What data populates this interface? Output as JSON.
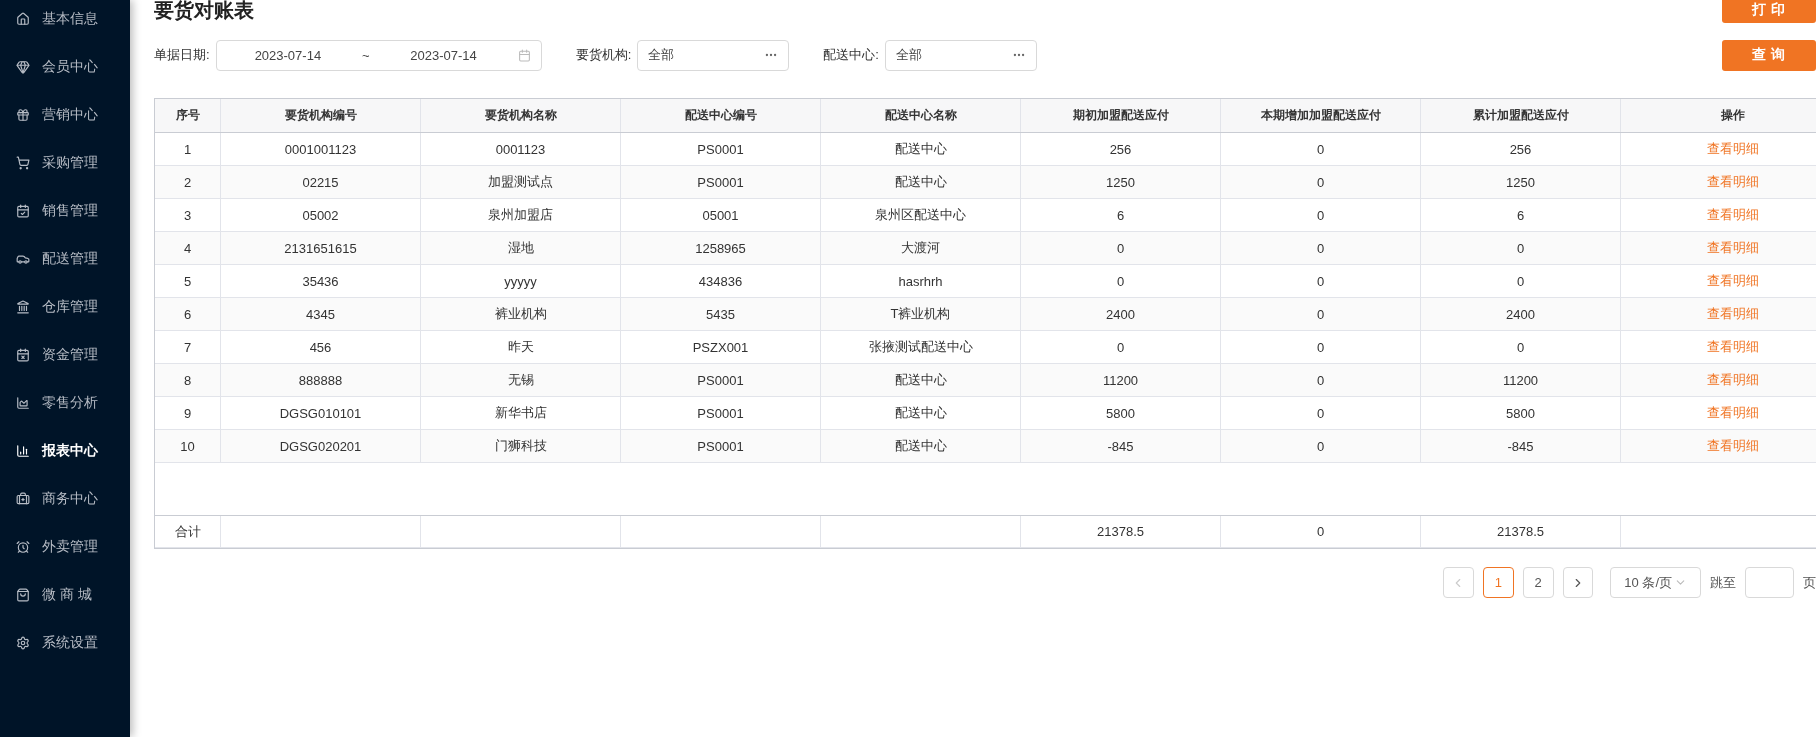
{
  "sidebar": {
    "items": [
      {
        "label": "基本信息",
        "selected": false
      },
      {
        "label": "会员中心",
        "selected": false
      },
      {
        "label": "营销中心",
        "selected": false
      },
      {
        "label": "采购管理",
        "selected": false
      },
      {
        "label": "销售管理",
        "selected": false
      },
      {
        "label": "配送管理",
        "selected": false
      },
      {
        "label": "仓库管理",
        "selected": false
      },
      {
        "label": "资金管理",
        "selected": false
      },
      {
        "label": "零售分析",
        "selected": false
      },
      {
        "label": "报表中心",
        "selected": true
      },
      {
        "label": "商务中心",
        "selected": false
      },
      {
        "label": "外卖管理",
        "selected": false
      },
      {
        "label": "微 商 城",
        "selected": false
      },
      {
        "label": "系统设置",
        "selected": false
      }
    ]
  },
  "title": "要货对账表",
  "print_button": "打 印",
  "query_button": "查 询",
  "filters": [
    {
      "kind": "daterange",
      "label": "单据日期:",
      "start": "2023-07-14",
      "separator": "~",
      "end": "2023-07-14"
    },
    {
      "kind": "select",
      "label": "要货机构:",
      "value": "全部"
    },
    {
      "kind": "select",
      "label": "配送中心:",
      "value": "全部"
    }
  ],
  "table": {
    "columns": [
      "序号",
      "要货机构编号",
      "要货机构名称",
      "配送中心编号",
      "配送中心名称",
      "期初加盟配送应付",
      "本期增加加盟配送应付",
      "累计加盟配送应付",
      "操作"
    ],
    "rows": [
      {
        "cells": [
          "1",
          "0001001123",
          "0001123",
          "PS0001",
          "配送中心",
          "256",
          "0",
          "256"
        ],
        "action": "查看明细"
      },
      {
        "cells": [
          "2",
          "02215",
          "加盟测试点",
          "PS0001",
          "配送中心",
          "1250",
          "0",
          "1250"
        ],
        "action": "查看明细"
      },
      {
        "cells": [
          "3",
          "05002",
          "泉州加盟店",
          "05001",
          "泉州区配送中心",
          "6",
          "0",
          "6"
        ],
        "action": "查看明细"
      },
      {
        "cells": [
          "4",
          "2131651615",
          "湿地",
          "1258965",
          "大渡河",
          "0",
          "0",
          "0"
        ],
        "action": "查看明细"
      },
      {
        "cells": [
          "5",
          "35436",
          "yyyyy",
          "434836",
          "hasrhrh",
          "0",
          "0",
          "0"
        ],
        "action": "查看明细"
      },
      {
        "cells": [
          "6",
          "4345",
          "裤业机构",
          "5435",
          "T裤业机构",
          "2400",
          "0",
          "2400"
        ],
        "action": "查看明细"
      },
      {
        "cells": [
          "7",
          "456",
          "昨天",
          "PSZX001",
          "张掖测试配送中心",
          "0",
          "0",
          "0"
        ],
        "action": "查看明细"
      },
      {
        "cells": [
          "8",
          "888888",
          "无锡",
          "PS0001",
          "配送中心",
          "11200",
          "0",
          "11200"
        ],
        "action": "查看明细"
      },
      {
        "cells": [
          "9",
          "DGSG010101",
          "新华书店",
          "PS0001",
          "配送中心",
          "5800",
          "0",
          "5800"
        ],
        "action": "查看明细"
      },
      {
        "cells": [
          "10",
          "DGSG020201",
          "门狮科技",
          "PS0001",
          "配送中心",
          "-845",
          "0",
          "-845"
        ],
        "action": "查看明细"
      }
    ],
    "total": {
      "label": "合计",
      "opening": "21378.5",
      "increase": "0",
      "cumulative": "21378.5"
    }
  },
  "pagination": {
    "pages": [
      {
        "label": "1",
        "selected": true
      },
      {
        "label": "2",
        "selected": false
      }
    ],
    "page_size": "10 条/页",
    "jump_label": "跳至",
    "page_suffix": "页"
  }
}
